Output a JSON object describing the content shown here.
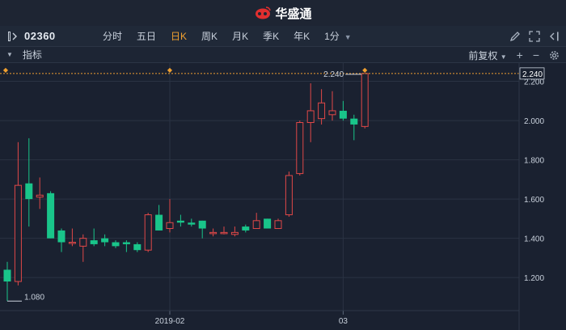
{
  "app": {
    "brand": "华盛通"
  },
  "toolbar": {
    "code": "02360",
    "periods": [
      {
        "label": "分时",
        "active": false
      },
      {
        "label": "五日",
        "active": false
      },
      {
        "label": "日K",
        "active": true
      },
      {
        "label": "周K",
        "active": false
      },
      {
        "label": "月K",
        "active": false
      },
      {
        "label": "季K",
        "active": false
      },
      {
        "label": "年K",
        "active": false
      },
      {
        "label": "1分",
        "active": false
      }
    ],
    "icons": [
      "pencil-icon",
      "fullscreen-icon",
      "collapse-panel-icon"
    ]
  },
  "indicator_bar": {
    "label": "指标",
    "adjust": "前复权",
    "icons": [
      "plus-icon",
      "minus-icon",
      "gear-icon"
    ]
  },
  "colors": {
    "up": "#e04848",
    "down": "#19c58a",
    "grid": "#2a3343",
    "accent": "#f0a030"
  },
  "chart_data": {
    "type": "candlestick",
    "ylim": [
      1.04,
      2.26
    ],
    "y_ticks": [
      "2.200",
      "2.000",
      "1.800",
      "1.600",
      "1.400",
      "1.200"
    ],
    "x_ticks": [
      {
        "index": 15,
        "label": "2019-02"
      },
      {
        "index": 31,
        "label": "03"
      }
    ],
    "current_price": "2.240",
    "max_label": "2.240",
    "min_label": "1.080",
    "candles": [
      {
        "o": 1.24,
        "h": 1.28,
        "l": 1.08,
        "c": 1.18
      },
      {
        "o": 1.18,
        "h": 1.89,
        "l": 1.16,
        "c": 1.67
      },
      {
        "o": 1.68,
        "h": 1.91,
        "l": 1.46,
        "c": 1.6
      },
      {
        "o": 1.61,
        "h": 1.71,
        "l": 1.55,
        "c": 1.62
      },
      {
        "o": 1.63,
        "h": 1.64,
        "l": 1.4,
        "c": 1.4
      },
      {
        "o": 1.44,
        "h": 1.45,
        "l": 1.33,
        "c": 1.38
      },
      {
        "o": 1.38,
        "h": 1.45,
        "l": 1.36,
        "c": 1.38
      },
      {
        "o": 1.36,
        "h": 1.42,
        "l": 1.28,
        "c": 1.4
      },
      {
        "o": 1.39,
        "h": 1.45,
        "l": 1.36,
        "c": 1.37
      },
      {
        "o": 1.4,
        "h": 1.42,
        "l": 1.36,
        "c": 1.38
      },
      {
        "o": 1.38,
        "h": 1.39,
        "l": 1.35,
        "c": 1.36
      },
      {
        "o": 1.38,
        "h": 1.39,
        "l": 1.33,
        "c": 1.37
      },
      {
        "o": 1.37,
        "h": 1.38,
        "l": 1.33,
        "c": 1.34
      },
      {
        "o": 1.34,
        "h": 1.53,
        "l": 1.33,
        "c": 1.52
      },
      {
        "o": 1.52,
        "h": 1.57,
        "l": 1.44,
        "c": 1.44
      },
      {
        "o": 1.45,
        "h": 1.6,
        "l": 1.43,
        "c": 1.48
      },
      {
        "o": 1.49,
        "h": 1.52,
        "l": 1.46,
        "c": 1.48
      },
      {
        "o": 1.48,
        "h": 1.5,
        "l": 1.46,
        "c": 1.47
      },
      {
        "o": 1.49,
        "h": 1.49,
        "l": 1.4,
        "c": 1.45
      },
      {
        "o": 1.43,
        "h": 1.45,
        "l": 1.41,
        "c": 1.43
      },
      {
        "o": 1.43,
        "h": 1.46,
        "l": 1.42,
        "c": 1.43
      },
      {
        "o": 1.42,
        "h": 1.46,
        "l": 1.41,
        "c": 1.43
      },
      {
        "o": 1.46,
        "h": 1.47,
        "l": 1.43,
        "c": 1.44
      },
      {
        "o": 1.45,
        "h": 1.53,
        "l": 1.45,
        "c": 1.49
      },
      {
        "o": 1.5,
        "h": 1.5,
        "l": 1.45,
        "c": 1.45
      },
      {
        "o": 1.45,
        "h": 1.5,
        "l": 1.45,
        "c": 1.49
      },
      {
        "o": 1.52,
        "h": 1.74,
        "l": 1.51,
        "c": 1.72
      },
      {
        "o": 1.73,
        "h": 2.0,
        "l": 1.72,
        "c": 1.99
      },
      {
        "o": 1.99,
        "h": 2.19,
        "l": 1.89,
        "c": 2.05
      },
      {
        "o": 2.01,
        "h": 2.16,
        "l": 1.98,
        "c": 2.09
      },
      {
        "o": 2.03,
        "h": 2.15,
        "l": 2.0,
        "c": 2.05
      },
      {
        "o": 2.05,
        "h": 2.1,
        "l": 2.0,
        "c": 2.01
      },
      {
        "o": 2.01,
        "h": 2.03,
        "l": 1.9,
        "c": 1.98
      },
      {
        "o": 1.97,
        "h": 2.24,
        "l": 1.96,
        "c": 2.24
      }
    ]
  }
}
